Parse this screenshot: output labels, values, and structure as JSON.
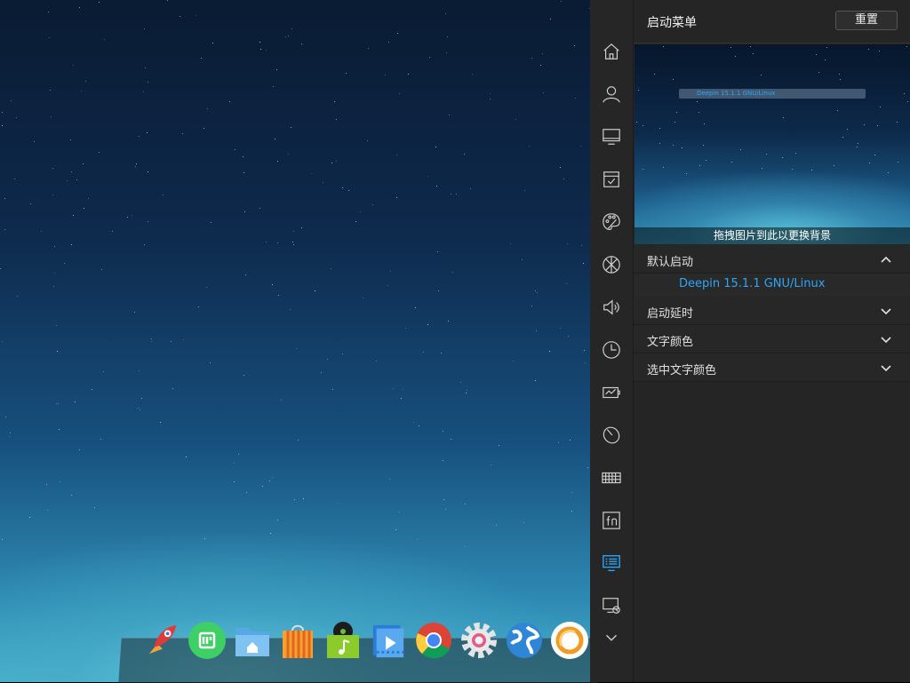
{
  "panel": {
    "title": "启动菜单",
    "reset_label": "重置",
    "preview": {
      "entry": "Deepin 15.1.1 GNU/Linux",
      "caption": "拖拽图片到此以更换背景"
    },
    "sections": [
      {
        "label": "默认启动",
        "expanded": true,
        "items": [
          "Deepin 15.1.1 GNU/Linux"
        ]
      },
      {
        "label": "启动延时",
        "expanded": false
      },
      {
        "label": "文字颜色",
        "expanded": false
      },
      {
        "label": "选中文字颜色",
        "expanded": false
      }
    ]
  },
  "sidebar": {
    "items": [
      {
        "icon": "home-icon"
      },
      {
        "icon": "user-icon"
      },
      {
        "icon": "monitor-icon"
      },
      {
        "icon": "default-apps-icon"
      },
      {
        "icon": "personalization-icon"
      },
      {
        "icon": "network-icon"
      },
      {
        "icon": "sound-icon"
      },
      {
        "icon": "clock-icon"
      },
      {
        "icon": "power-icon"
      },
      {
        "icon": "mouse-icon"
      },
      {
        "icon": "keyboard-icon"
      },
      {
        "icon": "fn-icon"
      },
      {
        "icon": "boot-menu-icon",
        "active": true
      },
      {
        "icon": "system-info-icon"
      },
      {
        "icon": "chevron-down-icon"
      }
    ]
  },
  "dock": {
    "apps": [
      {
        "icon": "launcher-rocket-icon"
      },
      {
        "icon": "deepin-store-green-icon"
      },
      {
        "icon": "file-manager-icon"
      },
      {
        "icon": "app-store-bag-icon"
      },
      {
        "icon": "music-icon"
      },
      {
        "icon": "video-player-icon"
      },
      {
        "icon": "chrome-icon"
      },
      {
        "icon": "settings-gear-icon"
      },
      {
        "icon": "browser-globe-icon"
      },
      {
        "icon": "orange-ring-icon"
      }
    ]
  },
  "colors": {
    "accent": "#2ca7f8",
    "panel_bg": "#252525",
    "sidebar_bg": "#262626"
  }
}
